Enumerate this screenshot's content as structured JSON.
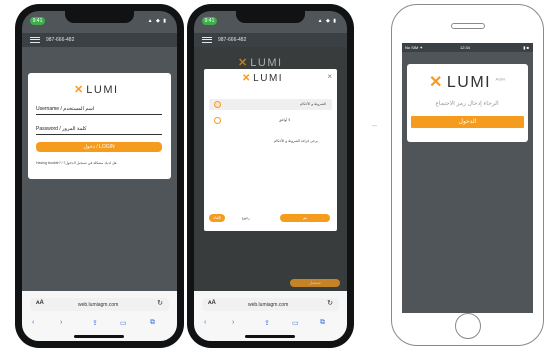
{
  "phones": {
    "status_badge": "9:41",
    "status_icons": "▲ ◆ ▮",
    "meeting_id": "987-666-482",
    "url": "web.lumiagm.com",
    "aa": "ᴀA",
    "reload": "↻"
  },
  "logo": {
    "x": "✕",
    "text": "LUMI",
    "tm": "AGM"
  },
  "login": {
    "username_label": "Username / اسم المستخدم",
    "password_label": "Password / كلمة المرور",
    "button": "دخول / LOGIN",
    "footer": "Having trouble? / هل لديك مشكلة في تسجيل الدخول؟"
  },
  "terms_modal": {
    "close": "×",
    "option1": "الشروط و الأحكام",
    "option2": "لا أوافق",
    "body": "يرجى قراءة الشروط و الأحكام",
    "ok": "تم",
    "cancel": "إلغاء",
    "cancel2": "رجوع",
    "bg_button": "تسجيل"
  },
  "white_phone": {
    "status_left": "No SIM ✦",
    "status_center": "12:34",
    "status_right": "▮ ■",
    "prompt": "الرجاء إدخال رمز الاجتماع",
    "button": "الدخول"
  },
  "separator": "–",
  "colors": {
    "accent": "#f59b1d",
    "screen": "#4f5558",
    "frame": "#111214"
  }
}
